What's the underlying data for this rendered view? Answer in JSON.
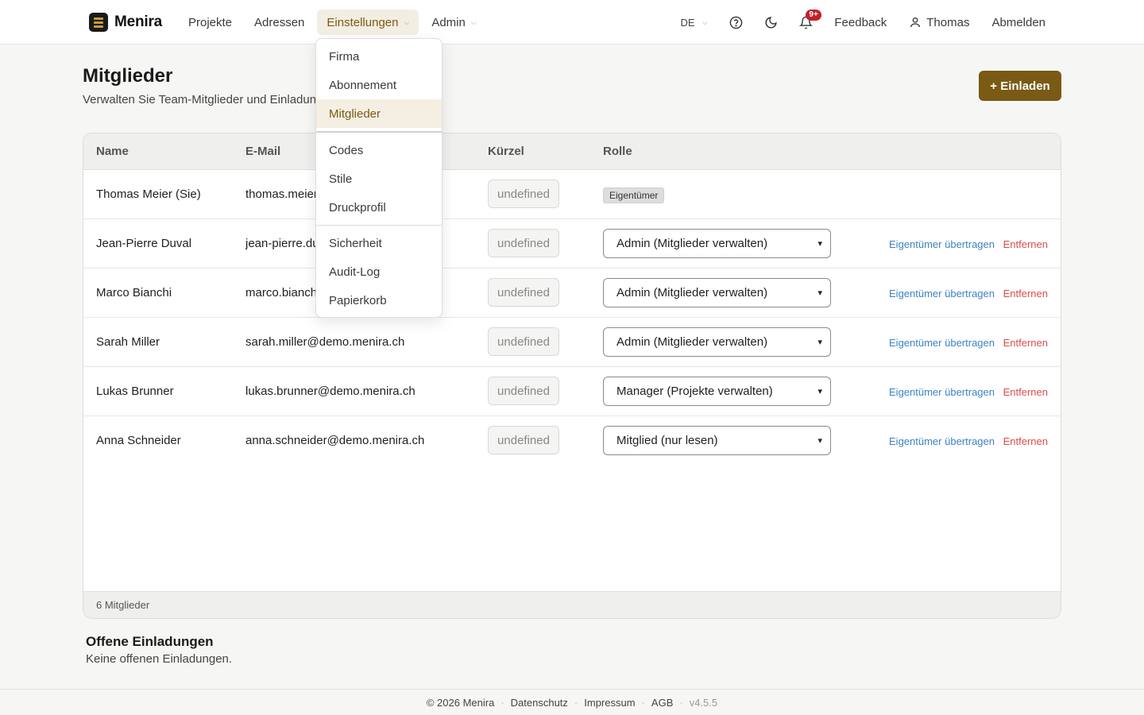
{
  "brand": {
    "name": "Menira"
  },
  "nav": {
    "items": [
      {
        "label": "Projekte"
      },
      {
        "label": "Adressen"
      },
      {
        "label": "Einstellungen"
      },
      {
        "label": "Admin"
      }
    ]
  },
  "header_right": {
    "lang": "DE",
    "notifications_badge": "9+",
    "feedback": "Feedback",
    "user": "Thomas",
    "logout": "Abmelden"
  },
  "page": {
    "title": "Mitglieder",
    "subtitle": "Verwalten Sie Team-Mitglieder und Einladungen",
    "invite_button": "+ Einladen"
  },
  "table": {
    "headers": {
      "name": "Name",
      "email": "E-Mail",
      "kuerzel": "Kürzel",
      "rolle": "Rolle"
    },
    "rows": [
      {
        "name": "Thomas Meier (Sie)",
        "email": "thomas.meier@demo.menira.ch",
        "kuerzel": "undefined",
        "role_tag": "Eigentümer"
      },
      {
        "name": "Jean-Pierre Duval",
        "email": "jean-pierre.duval@demo.menira.ch",
        "kuerzel": "undefined",
        "role": "Admin (Mitglieder verwalten)",
        "transfer": "Eigentümer übertragen",
        "remove": "Entfernen"
      },
      {
        "name": "Marco Bianchi",
        "email": "marco.bianchi@demo.menira.ch",
        "kuerzel": "undefined",
        "role": "Admin (Mitglieder verwalten)",
        "transfer": "Eigentümer übertragen",
        "remove": "Entfernen"
      },
      {
        "name": "Sarah Miller",
        "email": "sarah.miller@demo.menira.ch",
        "kuerzel": "undefined",
        "role": "Admin (Mitglieder verwalten)",
        "transfer": "Eigentümer übertragen",
        "remove": "Entfernen"
      },
      {
        "name": "Lukas Brunner",
        "email": "lukas.brunner@demo.menira.ch",
        "kuerzel": "undefined",
        "role": "Manager (Projekte verwalten)",
        "transfer": "Eigentümer übertragen",
        "remove": "Entfernen"
      },
      {
        "name": "Anna Schneider",
        "email": "anna.schneider@demo.menira.ch",
        "kuerzel": "undefined",
        "role": "Mitglied (nur lesen)",
        "transfer": "Eigentümer übertragen",
        "remove": "Entfernen"
      }
    ],
    "footer_count": "6 Mitglieder"
  },
  "invitations": {
    "title": "Offene Einladungen",
    "empty_text": "Keine offenen Einladungen."
  },
  "settings_menu": {
    "items": [
      {
        "label": "Firma"
      },
      {
        "label": "Abonnement"
      },
      {
        "label": "Mitglieder",
        "selected": true
      },
      {
        "label": "Codes"
      },
      {
        "label": "Stile"
      },
      {
        "label": "Druckprofil"
      },
      {
        "label": "Sicherheit"
      },
      {
        "label": "Audit-Log"
      },
      {
        "label": "Papierkorb"
      }
    ]
  },
  "footer": {
    "copyright": "© 2026 Menira",
    "privacy": "Datenschutz",
    "imprint": "Impressum",
    "terms": "AGB",
    "version": "v4.5.5"
  },
  "colors": {
    "accent": "#7a5a14",
    "link": "#3b82c4",
    "danger": "#dd4b4b",
    "badge": "#c0202a"
  }
}
